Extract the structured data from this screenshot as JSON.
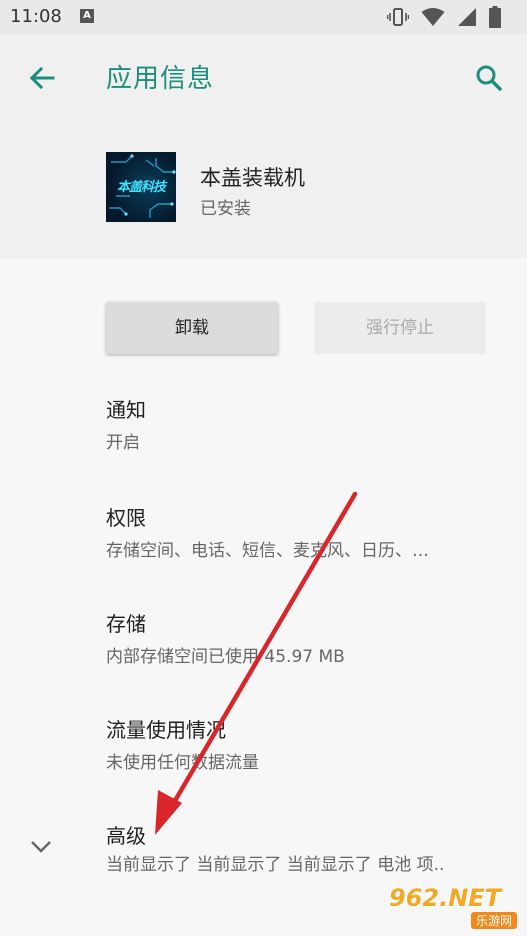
{
  "status_bar": {
    "time": "11:08",
    "notification_letter": "A"
  },
  "header": {
    "title": "应用信息",
    "back_icon": "arrow-left-icon",
    "search_icon": "search-icon"
  },
  "app": {
    "name": "本盖装载机",
    "status": "已安装",
    "icon_text": "本盖科技"
  },
  "buttons": {
    "uninstall": "卸载",
    "force_stop": "强行停止"
  },
  "settings": [
    {
      "title": "通知",
      "subtitle": "开启"
    },
    {
      "title": "权限",
      "subtitle": "存储空间、电话、短信、麦克风、日历、…"
    },
    {
      "title": "存储",
      "subtitle": "内部存储空间已使用 45.97 MB"
    },
    {
      "title": "流量使用情况",
      "subtitle": "未使用任何数据流量"
    },
    {
      "title": "高级",
      "subtitle": "当前显示了 当前显示了 当前显示了 电池 项.."
    }
  ],
  "watermark": {
    "top": "962.NET",
    "bottom": "乐游网"
  },
  "colors": {
    "accent": "#1d8e7e",
    "annotation_arrow": "#d9262b"
  }
}
